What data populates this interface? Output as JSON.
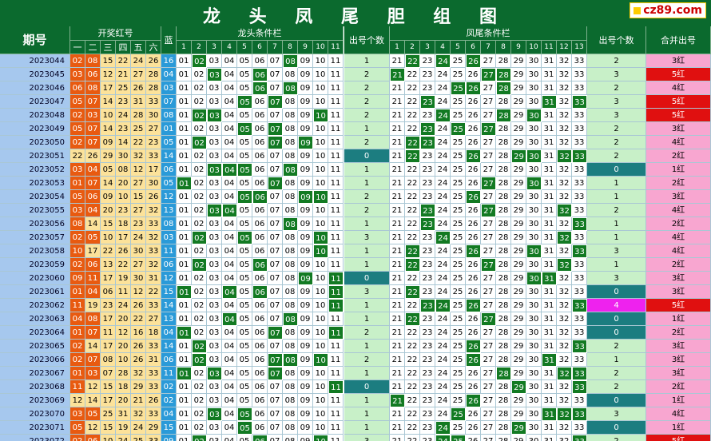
{
  "title": "龙 头 凤 尾 胆 组 图",
  "logo": "cz89.com",
  "headers": {
    "period": "期号",
    "red": "开奖红号",
    "red_cols": [
      "一",
      "二",
      "三",
      "四",
      "五",
      "六"
    ],
    "blue": "蓝",
    "head_cond": "龙头条件栏",
    "head_cols": [
      "1",
      "2",
      "3",
      "4",
      "5",
      "6",
      "7",
      "8",
      "9",
      "10",
      "11"
    ],
    "head_count": "出号个数",
    "tail_cond": "凤尾条件栏",
    "tail_cols": [
      "1",
      "2",
      "3",
      "4",
      "5",
      "6",
      "7",
      "8",
      "9",
      "10",
      "11",
      "12",
      "13"
    ],
    "tail_count": "出号个数",
    "merged": "合并出号"
  },
  "colors": {
    "title_bg": "#0b6a2e",
    "red_head": "#e85a10",
    "red_body": "#fce29a",
    "blue": "#2a9ad8",
    "hit": "#127a22",
    "count_bg": "#c8f0c8",
    "count_zero": "#1c7d80",
    "count_four": "#ee22ee",
    "merge_low": "#f8a6d0",
    "merge_high": "#e01010",
    "period_bg": "#a6c8ee"
  },
  "chart_data": {
    "type": "table",
    "head_values": [
      "01",
      "02",
      "03",
      "04",
      "05",
      "06",
      "07",
      "08",
      "09",
      "10",
      "11"
    ],
    "tail_values": [
      "21",
      "22",
      "23",
      "24",
      "25",
      "26",
      "27",
      "28",
      "29",
      "30",
      "31",
      "32",
      "33"
    ],
    "footer": {
      "period": "2023073",
      "head_total": "36",
      "tail_total": "36"
    },
    "rows": [
      {
        "period": "2023044",
        "reds": [
          "02",
          "08",
          "15",
          "22",
          "24",
          "26"
        ],
        "blue": "16",
        "head_count": "1",
        "tail_count": "2",
        "merged": "3红"
      },
      {
        "period": "2023045",
        "reds": [
          "03",
          "06",
          "12",
          "21",
          "27",
          "28"
        ],
        "blue": "04",
        "head_count": "2",
        "tail_count": "3",
        "merged": "5红"
      },
      {
        "period": "2023046",
        "reds": [
          "06",
          "08",
          "17",
          "25",
          "26",
          "28"
        ],
        "blue": "03",
        "head_count": "2",
        "tail_count": "2",
        "merged": "4红"
      },
      {
        "period": "2023047",
        "reds": [
          "05",
          "07",
          "14",
          "23",
          "31",
          "33"
        ],
        "blue": "07",
        "head_count": "2",
        "tail_count": "3",
        "merged": "5红"
      },
      {
        "period": "2023048",
        "reds": [
          "02",
          "03",
          "10",
          "24",
          "28",
          "30"
        ],
        "blue": "08",
        "head_count": "2",
        "tail_count": "3",
        "merged": "5红"
      },
      {
        "period": "2023049",
        "reds": [
          "05",
          "07",
          "14",
          "23",
          "25",
          "27"
        ],
        "blue": "01",
        "head_count": "1",
        "tail_count": "2",
        "merged": "3红"
      },
      {
        "period": "2023050",
        "reds": [
          "02",
          "07",
          "09",
          "14",
          "22",
          "23"
        ],
        "blue": "05",
        "head_count": "2",
        "tail_count": "2",
        "merged": "4红"
      },
      {
        "period": "2023051",
        "reds": [
          "22",
          "26",
          "29",
          "30",
          "32",
          "33"
        ],
        "blue": "14",
        "head_count": "0",
        "tail_count": "2",
        "merged": "2红"
      },
      {
        "period": "2023052",
        "reds": [
          "03",
          "04",
          "05",
          "08",
          "12",
          "17"
        ],
        "blue": "06",
        "head_count": "1",
        "tail_count": "0",
        "merged": "1红"
      },
      {
        "period": "2023053",
        "reds": [
          "01",
          "07",
          "14",
          "20",
          "27",
          "30"
        ],
        "blue": "05",
        "head_count": "1",
        "tail_count": "1",
        "merged": "2红"
      },
      {
        "period": "2023054",
        "reds": [
          "05",
          "06",
          "09",
          "10",
          "15",
          "26"
        ],
        "blue": "12",
        "head_count": "2",
        "tail_count": "1",
        "merged": "3红"
      },
      {
        "period": "2023055",
        "reds": [
          "03",
          "04",
          "20",
          "23",
          "27",
          "32"
        ],
        "blue": "13",
        "head_count": "2",
        "tail_count": "2",
        "merged": "4红"
      },
      {
        "period": "2023056",
        "reds": [
          "08",
          "14",
          "15",
          "18",
          "23",
          "33"
        ],
        "blue": "08",
        "head_count": "1",
        "tail_count": "1",
        "merged": "2红"
      },
      {
        "period": "2023057",
        "reds": [
          "02",
          "05",
          "10",
          "17",
          "24",
          "32"
        ],
        "blue": "03",
        "head_count": "3",
        "tail_count": "1",
        "merged": "4红"
      },
      {
        "period": "2023058",
        "reds": [
          "10",
          "17",
          "22",
          "26",
          "30",
          "33"
        ],
        "blue": "11",
        "head_count": "1",
        "tail_count": "3",
        "merged": "4红"
      },
      {
        "period": "2023059",
        "reds": [
          "02",
          "06",
          "13",
          "22",
          "27",
          "32"
        ],
        "blue": "06",
        "head_count": "1",
        "tail_count": "1",
        "merged": "2红"
      },
      {
        "period": "2023060",
        "reds": [
          "09",
          "11",
          "17",
          "19",
          "30",
          "31"
        ],
        "blue": "12",
        "head_count": "0",
        "tail_count": "3",
        "merged": "3红"
      },
      {
        "period": "2023061",
        "reds": [
          "01",
          "04",
          "06",
          "11",
          "12",
          "22"
        ],
        "blue": "15",
        "head_count": "3",
        "tail_count": "0",
        "merged": "3红"
      },
      {
        "period": "2023062",
        "reds": [
          "11",
          "19",
          "23",
          "24",
          "26",
          "33"
        ],
        "blue": "14",
        "head_count": "1",
        "tail_count": "4",
        "merged": "5红"
      },
      {
        "period": "2023063",
        "reds": [
          "04",
          "08",
          "17",
          "20",
          "22",
          "27"
        ],
        "blue": "13",
        "head_count": "1",
        "tail_count": "0",
        "merged": "1红"
      },
      {
        "period": "2023064",
        "reds": [
          "01",
          "07",
          "11",
          "12",
          "16",
          "18"
        ],
        "blue": "04",
        "head_count": "2",
        "tail_count": "0",
        "merged": "2红"
      },
      {
        "period": "2023065",
        "reds": [
          "02",
          "14",
          "17",
          "20",
          "26",
          "33"
        ],
        "blue": "14",
        "head_count": "1",
        "tail_count": "2",
        "merged": "3红"
      },
      {
        "period": "2023066",
        "reds": [
          "02",
          "07",
          "08",
          "10",
          "26",
          "31"
        ],
        "blue": "06",
        "head_count": "2",
        "tail_count": "1",
        "merged": "3红"
      },
      {
        "period": "2023067",
        "reds": [
          "01",
          "03",
          "07",
          "28",
          "32",
          "33"
        ],
        "blue": "11",
        "head_count": "1",
        "tail_count": "2",
        "merged": "3红"
      },
      {
        "period": "2023068",
        "reds": [
          "11",
          "12",
          "15",
          "18",
          "29",
          "33"
        ],
        "blue": "02",
        "head_count": "0",
        "tail_count": "2",
        "merged": "2红"
      },
      {
        "period": "2023069",
        "reds": [
          "12",
          "14",
          "17",
          "20",
          "21",
          "26"
        ],
        "blue": "02",
        "head_count": "1",
        "tail_count": "0",
        "merged": "1红"
      },
      {
        "period": "2023070",
        "reds": [
          "03",
          "05",
          "25",
          "31",
          "32",
          "33"
        ],
        "blue": "04",
        "head_count": "1",
        "tail_count": "3",
        "merged": "4红"
      },
      {
        "period": "2023071",
        "reds": [
          "05",
          "12",
          "15",
          "19",
          "24",
          "29"
        ],
        "blue": "15",
        "head_count": "1",
        "tail_count": "0",
        "merged": "1红"
      },
      {
        "period": "2023072",
        "reds": [
          "02",
          "06",
          "10",
          "24",
          "25",
          "33"
        ],
        "blue": "09",
        "head_count": "3",
        "tail_count": "2",
        "merged": "5红"
      }
    ]
  }
}
